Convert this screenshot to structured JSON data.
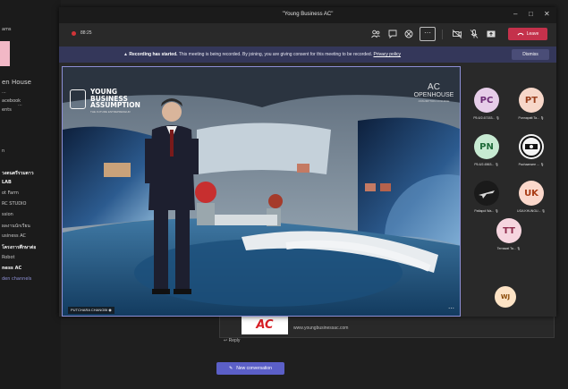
{
  "window": {
    "title": "\"Young Business AC\"",
    "minimize": "–",
    "maximize": "□",
    "close": "✕"
  },
  "toolbar": {
    "timer": "88:25",
    "more_label": "···",
    "leave_label": "Leave"
  },
  "banner": {
    "headline": "Recording has started.",
    "message": "This meeting is being recorded. By joining, you are giving consent for this meeting to be recorded.",
    "link": "Privacy policy",
    "dismiss_label": "Dismiss"
  },
  "stage": {
    "speaker_name": "PUTCHARA CHANGBI",
    "logo_line1": "YOUNG",
    "logo_line2": "BUSINESS",
    "logo_line3": "ASSUMPTION",
    "logo_sub": "THE FUTURE ENTREPRENEUR",
    "ac_line1": "AC",
    "ac_line2": "OPENHOUSE",
    "ac_line3": "ASSUMPTION COLLEGE"
  },
  "participants": [
    {
      "initials": "PC",
      "name": "P5-6/2-67153...",
      "bg": "#e6cde8",
      "fg": "#6b2a74"
    },
    {
      "initials": "PT",
      "name": "Punnapatt Ta...",
      "bg": "#f7d7c9",
      "fg": "#9a3f1d"
    },
    {
      "initials": "PN",
      "name": "P5-6/2-6563...",
      "bg": "#c7ead2",
      "fg": "#1f6b3a"
    },
    {
      "initials": "",
      "name": "Pachaarwee ...",
      "bg": "#f4f4f4",
      "fg": "#222222"
    },
    {
      "initials": "",
      "name": "Pattapol Wa...",
      "bg": "#1a1a1a",
      "fg": "#ffffff"
    },
    {
      "initials": "UK",
      "name": "UGA KHUNGU...",
      "bg": "#fbd8cb",
      "fg": "#a73a12"
    },
    {
      "initials": "TT",
      "name": "Terrawat Ta...",
      "bg": "#f6d5df",
      "fg": "#8f2c4d"
    }
  ],
  "extra_participant": {
    "initials": "WJ",
    "bg": "#fde3c5",
    "fg": "#8a4a07"
  },
  "background_app": {
    "sidebar": [
      {
        "text": "ams",
        "style": "item"
      },
      {
        "text": "en House",
        "style": "big"
      },
      {
        "text": "...",
        "style": "item"
      },
      {
        "text": "acebook",
        "style": "item"
      },
      {
        "text": "...",
        "style": "item"
      },
      {
        "text": "ents",
        "style": "item"
      },
      {
        "text": "n",
        "style": "item"
      },
      {
        "text": "วงดนตรีรวมดาว",
        "style": "bold"
      },
      {
        "text": "LAB",
        "style": "bold"
      },
      {
        "text": "ot Farm",
        "style": "item"
      },
      {
        "text": "RC STUDIO",
        "style": "item"
      },
      {
        "text": "ssion",
        "style": "item"
      },
      {
        "text": "ผลงานนักเรียน",
        "style": "item"
      },
      {
        "text": "usiness AC",
        "style": "item"
      },
      {
        "text": "โครงการศึกษาต่อ",
        "style": "bold"
      },
      {
        "text": "Robot",
        "style": "item"
      },
      {
        "text": "ness AC",
        "style": "bold"
      },
      {
        "text": "den channels",
        "style": "link"
      }
    ],
    "post_logo": "AC",
    "post_url": "www.youngbusinessac.com",
    "reply_label": "↩ Reply",
    "new_conversation_label": "New conversation"
  }
}
